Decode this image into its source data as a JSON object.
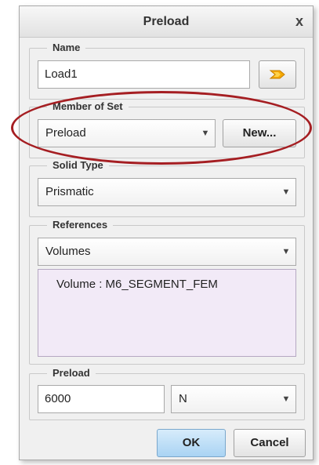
{
  "dialog": {
    "title": "Preload",
    "close_glyph": "x"
  },
  "name_group": {
    "legend": "Name",
    "value": "Load1",
    "color_button_icon": "color-swatch-icon",
    "color_button_color": "#f5a800"
  },
  "member_group": {
    "legend": "Member of Set",
    "selected": "Preload",
    "new_button": "New..."
  },
  "solid_group": {
    "legend": "Solid Type",
    "selected": "Prismatic"
  },
  "references_group": {
    "legend": "References",
    "selected": "Volumes",
    "items": [
      "Volume : M6_SEGMENT_FEM"
    ]
  },
  "preload_group": {
    "legend": "Preload",
    "value": "6000",
    "unit": "N"
  },
  "footer": {
    "ok": "OK",
    "cancel": "Cancel"
  },
  "annotation": {
    "highlight_color": "#a51e22"
  }
}
